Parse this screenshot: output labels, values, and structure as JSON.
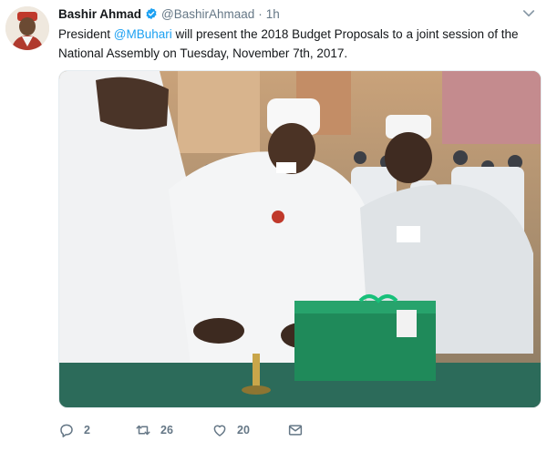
{
  "author": {
    "display_name": "Bashir Ahmad",
    "handle": "@BashirAhmaad",
    "separator": "·",
    "time": "1h",
    "verified": true
  },
  "text": {
    "part1": "President ",
    "mention": "@MBuhari",
    "part2": " will present the 2018 Budget Proposals to a joint session of the National Assembly on Tuesday, November 7th, 2017."
  },
  "actions": {
    "reply_count": "2",
    "retweet_count": "26",
    "like_count": "20",
    "dm_count": ""
  },
  "icons": {
    "verified": "verified-badge-icon",
    "caret": "chevron-down-icon",
    "reply": "reply-icon",
    "retweet": "retweet-icon",
    "like": "heart-icon",
    "dm": "envelope-icon"
  },
  "colors": {
    "link": "#1da1f2",
    "secondary_text": "#657786",
    "primary_text": "#14171a",
    "budget_box": "#1f8a5a"
  }
}
